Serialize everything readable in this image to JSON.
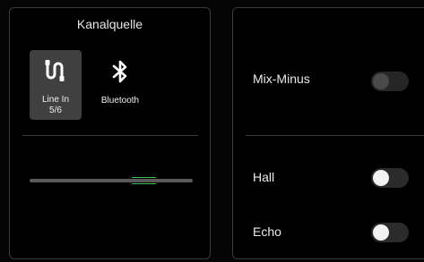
{
  "channel_source": {
    "title": "Kanalquelle",
    "sources": [
      {
        "label_line1": "Line In",
        "label_line2": "5/6",
        "icon": "line-in-icon",
        "selected": true
      },
      {
        "label": "Bluetooth",
        "icon": "bluetooth-icon",
        "selected": false
      }
    ]
  },
  "level_slider": {
    "level": 0.7,
    "accent": "#3ec24a"
  },
  "settings": {
    "mix_minus": {
      "label": "Mix-Minus",
      "on": false,
      "enabled": false
    },
    "hall": {
      "label": "Hall",
      "on": false
    },
    "echo": {
      "label": "Echo",
      "on": false
    }
  }
}
